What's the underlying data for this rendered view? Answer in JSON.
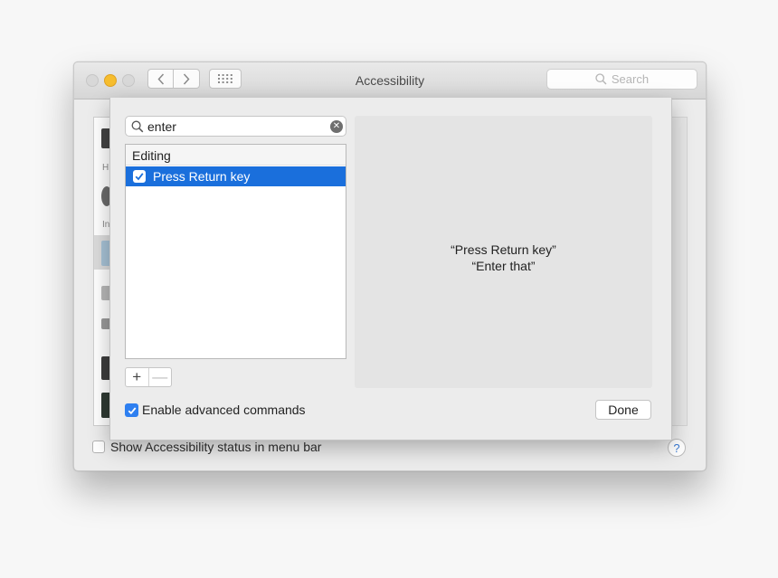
{
  "window": {
    "title": "Accessibility",
    "search_placeholder": "Search"
  },
  "sidebar_fragments": [
    "H",
    "In"
  ],
  "status_bar": {
    "checkbox_label": "Show Accessibility status in menu bar",
    "checked": false,
    "help_label": "?"
  },
  "sheet": {
    "search_value": "enter",
    "groups": [
      {
        "name": "Editing",
        "items": [
          {
            "label": "Press Return key",
            "checked": true,
            "selected": true
          }
        ]
      }
    ],
    "add_label": "+",
    "remove_label": "—",
    "detail_phrases": [
      "“Press Return key”",
      "“Enter that”"
    ],
    "enable_label": "Enable advanced commands",
    "enable_checked": true,
    "done_label": "Done"
  },
  "icons": {
    "search": "magnifier-icon",
    "clear": "clear-circle-icon",
    "back": "chevron-left-icon",
    "forward": "chevron-right-icon",
    "grid": "grid-icon",
    "check": "checkmark-icon"
  },
  "colors": {
    "selection": "#1a6fdc",
    "checkbox_accent": "#2e7ff0",
    "minimize": "#f6bd2e"
  }
}
